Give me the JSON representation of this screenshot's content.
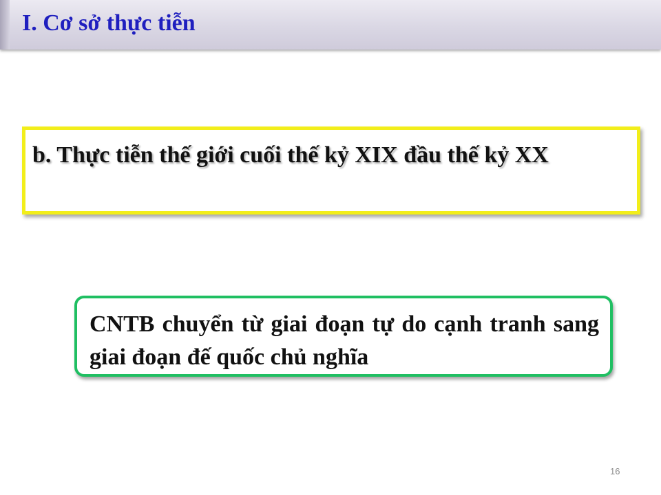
{
  "header": {
    "title": "I. Cơ sở thực tiễn"
  },
  "section": {
    "heading": "b. Thực tiễn thế giới cuối thế kỷ XIX đầu thế kỷ XX"
  },
  "callout": {
    "text": "CNTB chuyển từ giai đoạn tự do cạnh tranh sang giai đoạn đế quốc chủ nghĩa"
  },
  "footer": {
    "page_number": "16"
  },
  "colors": {
    "title": "#1f1fbf",
    "section_border": "#f2ee1a",
    "callout_border": "#1fbf62"
  }
}
